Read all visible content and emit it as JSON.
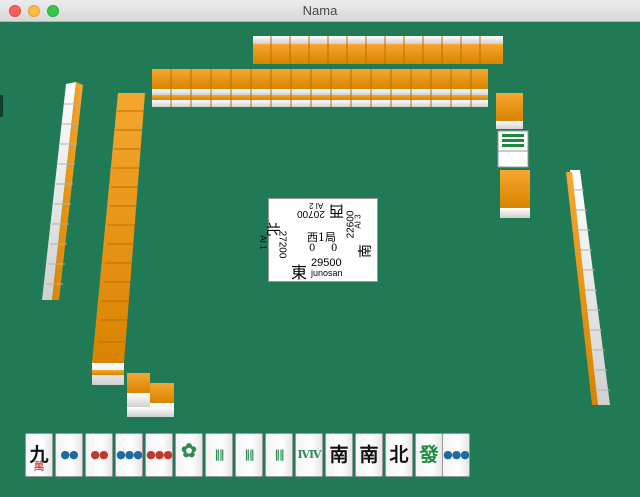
{
  "window": {
    "title": "Nama"
  },
  "board": {
    "round": "西1局",
    "honba": "0",
    "riichi": "0",
    "east": {
      "wind": "東",
      "score": "29500",
      "name": "junosan"
    },
    "south": {
      "wind": "南",
      "score": "22600",
      "name": "AI 3"
    },
    "west": {
      "wind": "西",
      "score": "20700",
      "name": "AI 2"
    },
    "north": {
      "wind": "北",
      "score": "27200",
      "name": "AI 1"
    }
  },
  "hand": {
    "tiles": [
      {
        "name": "9-man",
        "glyph": "九",
        "sub": "萬",
        "color": "#111111"
      },
      {
        "name": "2-pin",
        "glyph": "●●",
        "color": "#1f6aa0"
      },
      {
        "name": "4-pin",
        "glyph": "●●",
        "color": "#c0392b"
      },
      {
        "name": "6-pin",
        "glyph": "●●●",
        "color": "#1f6aa0"
      },
      {
        "name": "9-pin",
        "glyph": "●●●",
        "color": "#c0392b"
      },
      {
        "name": "1-sou",
        "glyph": "✿",
        "color": "#2e8b57"
      },
      {
        "name": "4-sou",
        "glyph": "‖‖",
        "color": "#2e8b57"
      },
      {
        "name": "5-sou",
        "glyph": "‖‖",
        "color": "#2e8b57"
      },
      {
        "name": "6-sou",
        "glyph": "‖‖",
        "color": "#2e8b57"
      },
      {
        "name": "8-sou",
        "glyph": "ⅣⅣ",
        "color": "#2e8b57"
      },
      {
        "name": "south-wind",
        "glyph": "南",
        "color": "#111111"
      },
      {
        "name": "south-wind",
        "glyph": "南",
        "color": "#111111"
      },
      {
        "name": "north-wind",
        "glyph": "北",
        "color": "#111111"
      },
      {
        "name": "green-dragon",
        "glyph": "發",
        "color": "#1c8a3c"
      }
    ],
    "drawn": {
      "name": "9-pin",
      "glyph": "●●●",
      "color": "#1f6aa0"
    }
  }
}
